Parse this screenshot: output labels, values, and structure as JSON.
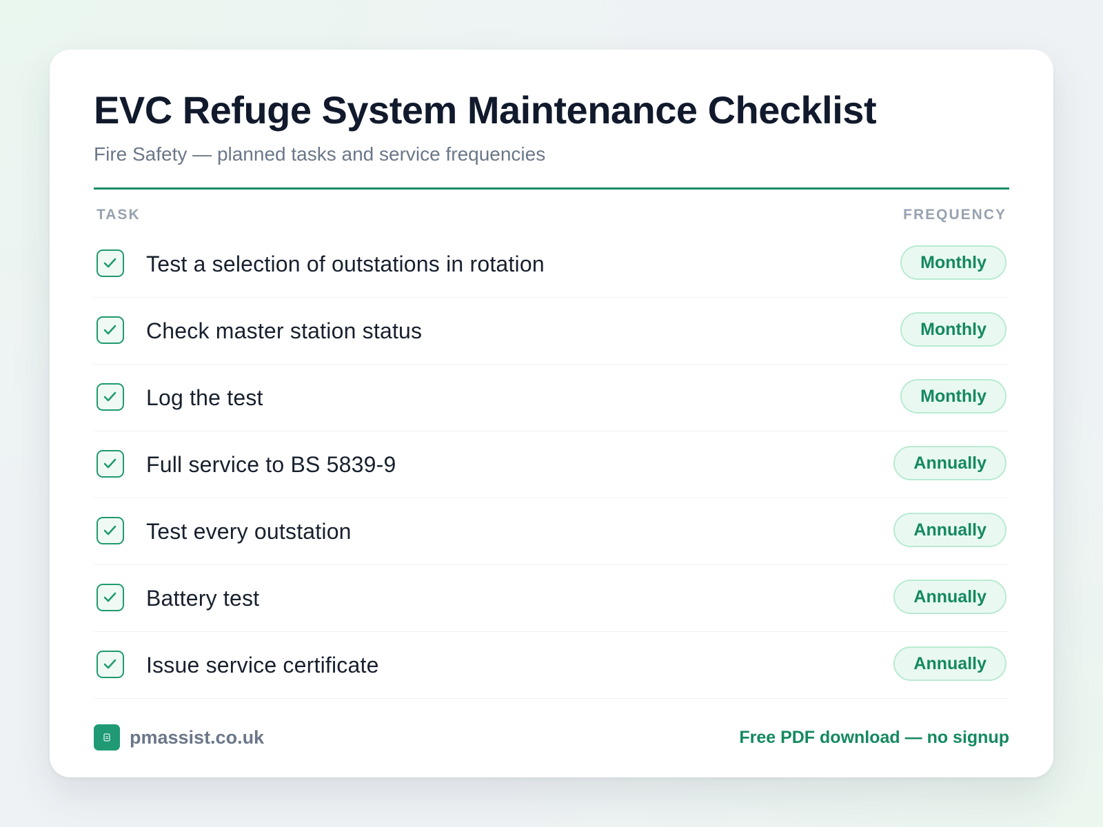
{
  "header": {
    "title": "EVC Refuge System Maintenance Checklist",
    "subtitle": "Fire Safety — planned tasks and service frequencies"
  },
  "columns": {
    "task": "TASK",
    "frequency": "FREQUENCY"
  },
  "items": [
    {
      "task": "Test a selection of outstations in rotation",
      "frequency": "Monthly",
      "checked": true
    },
    {
      "task": "Check master station status",
      "frequency": "Monthly",
      "checked": true
    },
    {
      "task": "Log the test",
      "frequency": "Monthly",
      "checked": true
    },
    {
      "task": "Full service to BS 5839-9",
      "frequency": "Annually",
      "checked": true
    },
    {
      "task": "Test every outstation",
      "frequency": "Annually",
      "checked": true
    },
    {
      "task": "Battery test",
      "frequency": "Annually",
      "checked": true
    },
    {
      "task": "Issue service certificate",
      "frequency": "Annually",
      "checked": true
    }
  ],
  "footer": {
    "site": "pmassist.co.uk",
    "cta": "Free PDF download — no signup",
    "logo_icon": "document-icon"
  },
  "colors": {
    "accent": "#1a8c63",
    "badge_bg": "#e9f9f1",
    "title": "#111a2c"
  }
}
